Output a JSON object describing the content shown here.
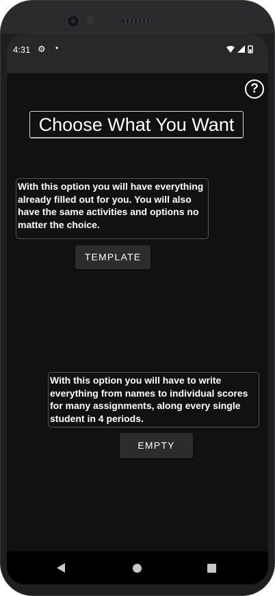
{
  "status_bar": {
    "time": "4:31",
    "settings_icon": "gear-icon",
    "notification_dot": "•",
    "icons": [
      "wifi-icon",
      "signal-icon",
      "battery-icon"
    ]
  },
  "help": {
    "icon": "help-icon",
    "label": "?"
  },
  "title": "Choose What You Want",
  "options": {
    "template": {
      "description": "With this option you will have everything already filled out for you. You will also have the same activities and options no matter the choice.",
      "button_label": "TEMPLATE"
    },
    "empty": {
      "description": "With this option you will have to write everything from names to individual scores for many assignments, along every single student in 4 periods.",
      "button_label": "EMPTY"
    }
  },
  "nav_bar": {
    "icons": [
      "back-icon",
      "home-icon",
      "recents-icon"
    ]
  },
  "colors": {
    "background": "#111112",
    "status_bar": "#282828",
    "button": "#2c2c2c",
    "text": "#ffffff"
  }
}
